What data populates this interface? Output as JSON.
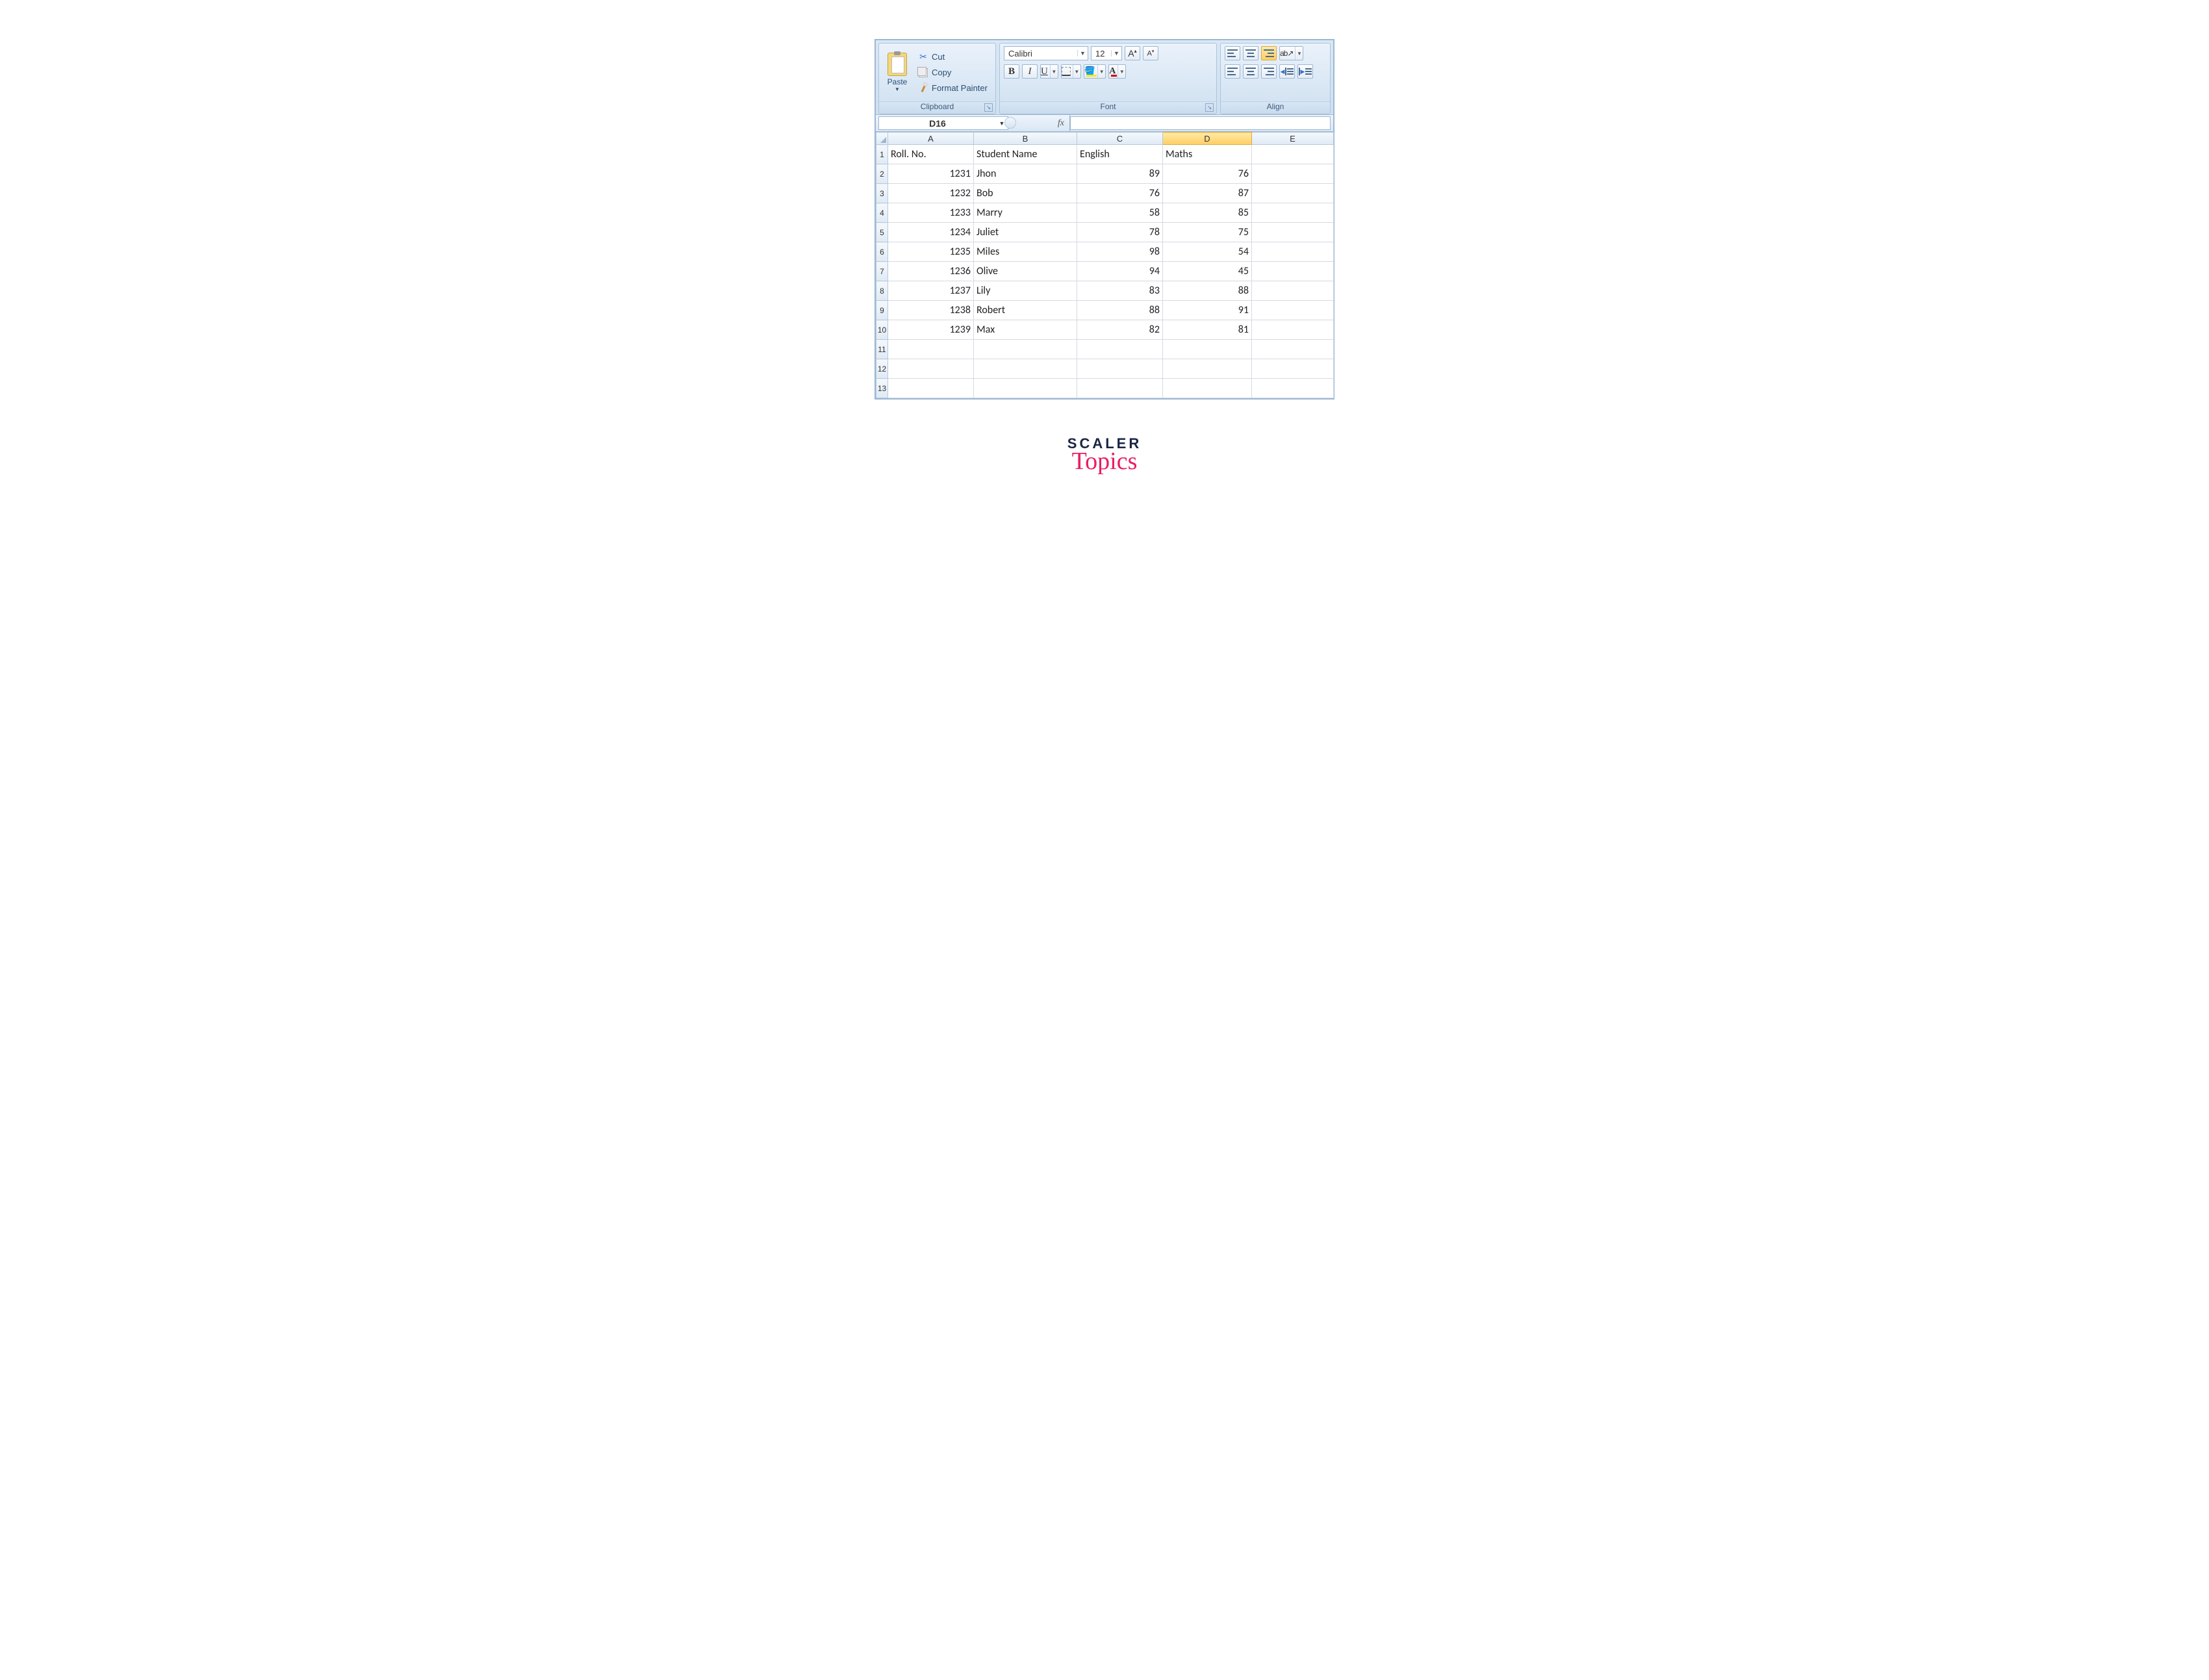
{
  "ribbon": {
    "clipboard": {
      "label": "Clipboard",
      "paste": "Paste",
      "cut": "Cut",
      "copy": "Copy",
      "format_painter": "Format Painter"
    },
    "font": {
      "label": "Font",
      "name": "Calibri",
      "size": "12"
    },
    "align": {
      "label": "Align"
    }
  },
  "namebox": "D16",
  "fx": "fx",
  "columns": [
    "A",
    "B",
    "C",
    "D",
    "E"
  ],
  "selected_column": "D",
  "rows": [
    "1",
    "2",
    "3",
    "4",
    "5",
    "6",
    "7",
    "8",
    "9",
    "10",
    "11",
    "12",
    "13"
  ],
  "headers": {
    "a": "Roll. No.",
    "b": "Student Name",
    "c": "English",
    "d": "Maths"
  },
  "data": [
    {
      "roll": "1231",
      "name": "Jhon",
      "eng": "89",
      "math": "76"
    },
    {
      "roll": "1232",
      "name": "Bob",
      "eng": "76",
      "math": "87"
    },
    {
      "roll": "1233",
      "name": "Marry",
      "eng": "58",
      "math": "85"
    },
    {
      "roll": "1234",
      "name": "Juliet",
      "eng": "78",
      "math": "75"
    },
    {
      "roll": "1235",
      "name": "Miles",
      "eng": "98",
      "math": "54"
    },
    {
      "roll": "1236",
      "name": "Olive",
      "eng": "94",
      "math": "45"
    },
    {
      "roll": "1237",
      "name": "Lily",
      "eng": "83",
      "math": "88"
    },
    {
      "roll": "1238",
      "name": "Robert",
      "eng": "88",
      "math": "91"
    },
    {
      "roll": "1239",
      "name": "Max",
      "eng": "82",
      "math": "81"
    }
  ],
  "logo": {
    "line1": "SCALER",
    "line2": "Topics"
  }
}
